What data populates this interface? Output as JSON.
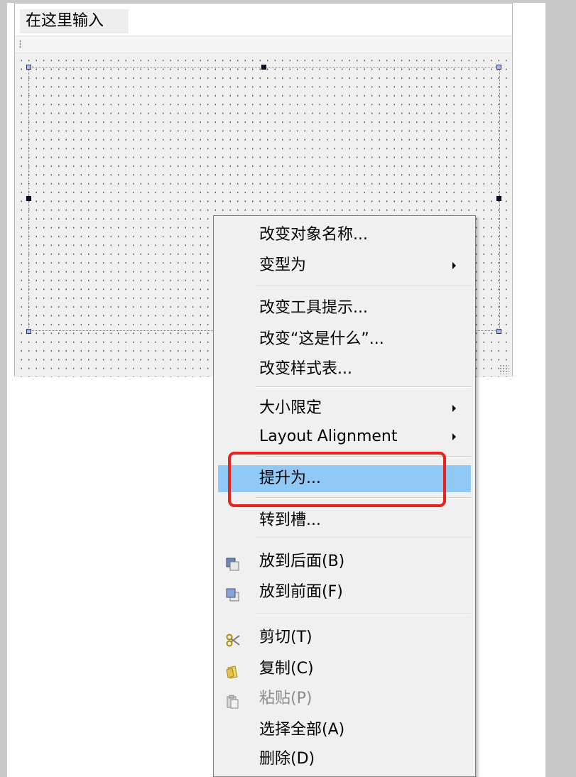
{
  "form": {
    "menubar_placeholder": "在这里输入"
  },
  "context_menu": {
    "items": [
      {
        "label": "改变对象名称..."
      },
      {
        "label": "变型为"
      },
      {
        "label": "改变工具提示..."
      },
      {
        "label": "改变“这是什么”..."
      },
      {
        "label": "改变样式表..."
      },
      {
        "label": "大小限定"
      },
      {
        "label": "Layout Alignment"
      },
      {
        "label": "提升为..."
      },
      {
        "label": "转到槽..."
      },
      {
        "label": "放到后面(B)"
      },
      {
        "label": "放到前面(F)"
      },
      {
        "label": "剪切(T)"
      },
      {
        "label": "复制(C)"
      },
      {
        "label": "粘贴(P)"
      },
      {
        "label": "选择全部(A)"
      },
      {
        "label": "删除(D)"
      }
    ]
  },
  "colors": {
    "highlight": "#90c8f6",
    "annotation": "#e8221c"
  },
  "icons": [
    "submenu-arrow-icon",
    "send-to-back-icon",
    "bring-to-front-icon",
    "cut-icon",
    "copy-icon",
    "paste-icon"
  ]
}
